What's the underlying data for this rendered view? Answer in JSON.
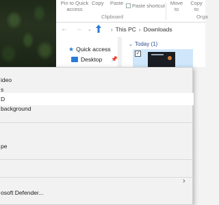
{
  "ribbon": {
    "pin_label": "Pin to Quick access",
    "copy_label": "Copy",
    "paste_label": "Paste",
    "paste_shortcut_label": "Paste shortcut",
    "move_to_label": "Move to",
    "copy_to_label": "Copy to",
    "clipboard_group": "Clipboard",
    "organize_group": "Orga"
  },
  "address": {
    "path": [
      "This PC",
      "Downloads"
    ]
  },
  "nav_pane": {
    "quick_access": "Quick access",
    "desktop": "Desktop"
  },
  "content": {
    "group_label": "Today (1)"
  },
  "context_menu": {
    "items": [
      "ideo",
      "s",
      "D",
      "background",
      "pe",
      "osoft Defender..."
    ]
  },
  "colors": {
    "accent": "#2b7bd6",
    "selection": "#cfe6fb",
    "menu_bg": "#f2f2f2"
  }
}
